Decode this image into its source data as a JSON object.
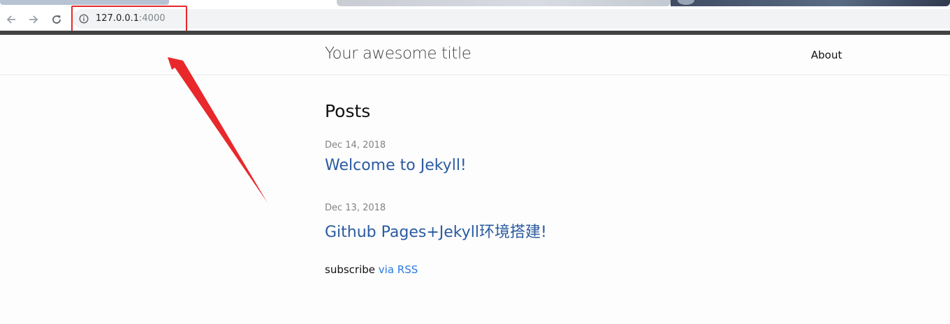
{
  "browser": {
    "url_host": "127.0.0.1",
    "url_port": ":4000",
    "icons": {
      "back": "back-arrow-icon",
      "forward": "forward-arrow-icon",
      "reload": "reload-icon",
      "info": "info-icon"
    }
  },
  "site": {
    "title": "Your awesome title",
    "nav": {
      "about": "About"
    }
  },
  "main": {
    "heading": "Posts",
    "posts": [
      {
        "date": "Dec 14, 2018",
        "title": "Welcome to Jekyll!"
      },
      {
        "date": "Dec 13, 2018",
        "title": "Github Pages+Jekyll环境搭建!"
      }
    ],
    "subscribe": {
      "text": "subscribe",
      "link": "via RSS"
    }
  },
  "annotation": {
    "color": "#e8282b"
  },
  "colors": {
    "link": "#2a5ba0",
    "rss_link": "#2a7ae2",
    "meta": "#828282",
    "topbar": "#424242"
  }
}
